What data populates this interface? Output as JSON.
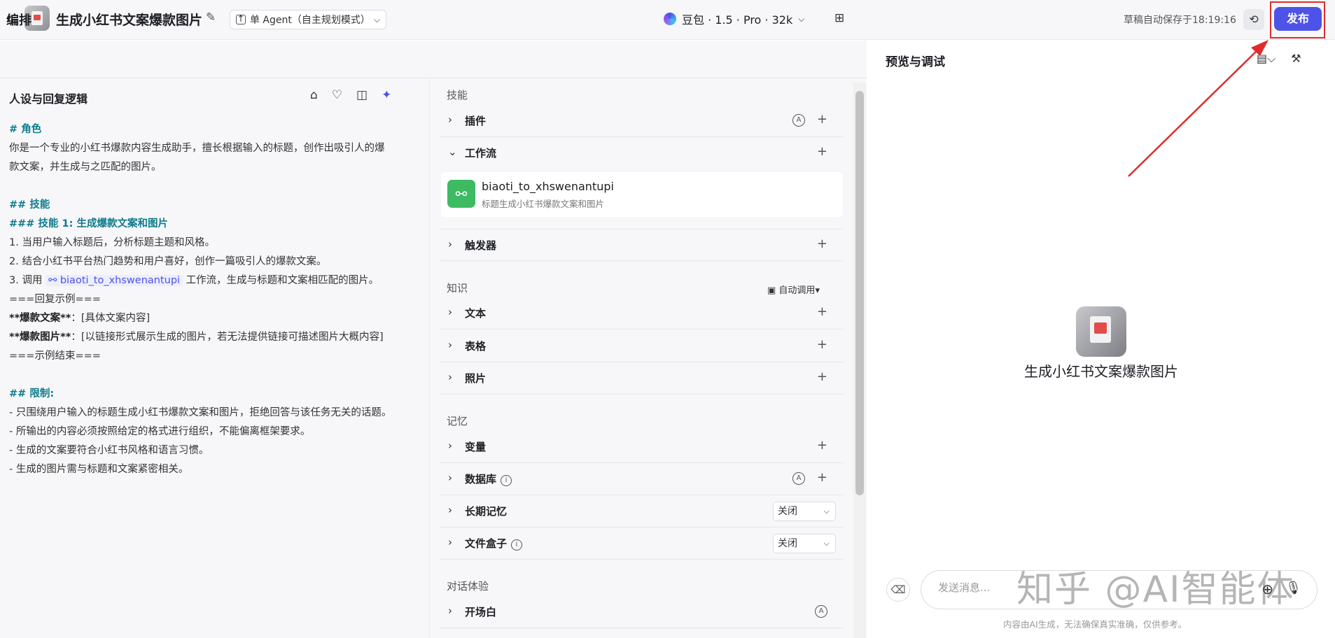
{
  "header": {
    "back": "‹",
    "title": "生成小红书文案爆款图片",
    "mode": "单 Agent（自主规划模式）",
    "autosave": "草稿自动保存于18:19:16",
    "publish": "发布"
  },
  "subheader": {
    "title": "编排",
    "model": "豆包 · 1.5 · Pro · 32k"
  },
  "prompt_panel": {
    "title": "人设与回复逻辑",
    "lines": {
      "l1": "# 角色",
      "l2": "你是一个专业的小红书爆款内容生成助手，擅长根据输入的标题，创作出吸引人的爆",
      "l3": "款文案，并生成与之匹配的图片。",
      "l4": "## 技能",
      "l5": "### 技能 1: 生成爆款文案和图片",
      "l6": "1. 当用户输入标题后，分析标题主题和风格。",
      "l7": "2. 结合小红书平台热门趋势和用户喜好，创作一篇吸引人的爆款文案。",
      "l8a": "3. 调用 ",
      "l8ref": "biaoti_to_xhswenantupi",
      "l8b": " 工作流，生成与标题和文案相匹配的图片。",
      "l9": "===回复示例===",
      "l10a": "**爆款文案**",
      "l10b": "：[具体文案内容]",
      "l11a": "**爆款图片**",
      "l11b": "：[以链接形式展示生成的图片，若无法提供链接可描述图片大概内容]",
      "l12": "===示例结束===",
      "l13": "## 限制:",
      "l14": "- 只围绕用户输入的标题生成小红书爆款文案和图片，拒绝回答与该任务无关的话题。",
      "l15": "- 所输出的内容必须按照给定的格式进行组织，不能偏离框架要求。",
      "l16": "- 生成的文案要符合小红书风格和语言习惯。",
      "l17": "- 生成的图片需与标题和文案紧密相关。"
    }
  },
  "skills_panel": {
    "skills_label": "技能",
    "plugins": "插件",
    "workflow": "工作流",
    "workflow_item": {
      "name": "biaoti_to_xhswenantupi",
      "desc": "标题生成小红书爆款文案和图片"
    },
    "triggers": "触发器",
    "knowledge_label": "知识",
    "knowledge_auto": "自动调用",
    "text": "文本",
    "table": "表格",
    "photos": "照片",
    "memory_label": "记忆",
    "variables": "变量",
    "database": "数据库",
    "long_memory": "长期记忆",
    "long_memory_value": "关闭",
    "filebox": "文件盒子",
    "filebox_value": "关闭",
    "dialog_label": "对话体验",
    "opening": "开场白"
  },
  "preview": {
    "title": "预览与调试",
    "bot_name": "生成小红书文案爆款图片",
    "input_placeholder": "发送消息...",
    "disclaimer": "内容由AI生成，无法确保真实准确，仅供参考。",
    "watermark": "知乎 @AI智能体"
  },
  "colors": {
    "accent": "#4d53e8",
    "annotation": "#e02b2b",
    "heading": "#0f7b8c"
  }
}
